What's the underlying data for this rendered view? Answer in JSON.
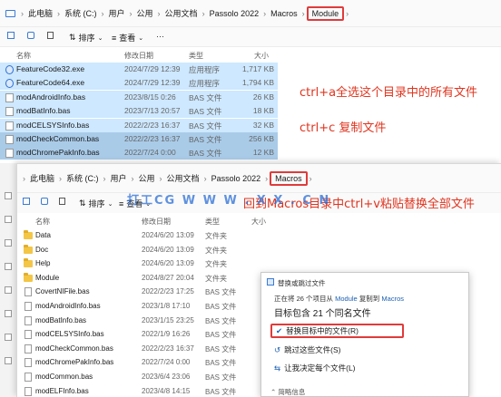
{
  "back_window": {
    "breadcrumbs": [
      "此电脑",
      "系统 (C:)",
      "用户",
      "公用",
      "公用文档",
      "Passolo 2022",
      "Macros",
      "Module"
    ],
    "toolbar": {
      "sort": "排序",
      "view": "查看",
      "more": "···"
    },
    "columns": {
      "name": "名称",
      "date": "修改日期",
      "type": "类型",
      "size": "大小"
    },
    "files": [
      {
        "name": "FeatureCode32.exe",
        "date": "2024/7/29 12:39",
        "type": "应用程序",
        "size": "1,717 KB"
      },
      {
        "name": "FeatureCode64.exe",
        "date": "2024/7/29 12:39",
        "type": "应用程序",
        "size": "1,794 KB"
      },
      {
        "name": "modAndroidInfo.bas",
        "date": "2023/8/15 0:26",
        "type": "BAS 文件",
        "size": "26 KB"
      },
      {
        "name": "modBatInfo.bas",
        "date": "2023/7/13 20:57",
        "type": "BAS 文件",
        "size": "18 KB"
      },
      {
        "name": "modCELSYSInfo.bas",
        "date": "2022/2/23 16:37",
        "type": "BAS 文件",
        "size": "32 KB"
      },
      {
        "name": "modCheckCommon.bas",
        "date": "2022/2/23 16:37",
        "type": "BAS 文件",
        "size": "256 KB"
      },
      {
        "name": "modChromePakInfo.bas",
        "date": "2022/7/24 0:00",
        "type": "BAS 文件",
        "size": "12 KB"
      }
    ]
  },
  "annotations": {
    "select_all": "ctrl+a全选这个目录中的所有文件",
    "copy": "ctrl+c 复制文件",
    "paste": "回到Macros目录中ctrl+v粘贴替换全部文件"
  },
  "watermark": "打工CG  W W W . X X . C N",
  "front_window": {
    "breadcrumbs": [
      "此电脑",
      "系统 (C:)",
      "用户",
      "公用",
      "公用文档",
      "Passolo 2022",
      "Macros"
    ],
    "toolbar": {
      "sort": "排序",
      "view": "查看",
      "more": "···"
    },
    "columns": {
      "name": "名称",
      "date": "修改日期",
      "type": "类型",
      "size": "大小"
    },
    "items": [
      {
        "name": "Data",
        "date": "2024/6/20 13:09",
        "type": "文件夹",
        "kind": "folder"
      },
      {
        "name": "Doc",
        "date": "2024/6/20 13:09",
        "type": "文件夹",
        "kind": "folder"
      },
      {
        "name": "Help",
        "date": "2024/6/20 13:09",
        "type": "文件夹",
        "kind": "folder"
      },
      {
        "name": "Module",
        "date": "2024/8/27 20:04",
        "type": "文件夹",
        "kind": "folder"
      },
      {
        "name": "CovertNIFile.bas",
        "date": "2022/2/23 17:25",
        "type": "BAS 文件",
        "kind": "file"
      },
      {
        "name": "modAndroidInfo.bas",
        "date": "2023/1/8 17:10",
        "type": "BAS 文件",
        "kind": "file"
      },
      {
        "name": "modBatInfo.bas",
        "date": "2023/1/15 23:25",
        "type": "BAS 文件",
        "kind": "file"
      },
      {
        "name": "modCELSYSInfo.bas",
        "date": "2022/1/9 16:26",
        "type": "BAS 文件",
        "kind": "file"
      },
      {
        "name": "modCheckCommon.bas",
        "date": "2022/2/23 16:37",
        "type": "BAS 文件",
        "kind": "file"
      },
      {
        "name": "modChromePakInfo.bas",
        "date": "2022/7/24 0:00",
        "type": "BAS 文件",
        "kind": "file"
      },
      {
        "name": "modCommon.bas",
        "date": "2023/6/4 23:06",
        "type": "BAS 文件",
        "kind": "file"
      },
      {
        "name": "modELFInfo.bas",
        "date": "2023/4/8 14:15",
        "type": "BAS 文件",
        "kind": "file"
      }
    ]
  },
  "dialog": {
    "title": "替换或跳过文件",
    "status_prefix": "正在将 26 个项目从",
    "status_source": "Module",
    "status_mid": "复制到",
    "status_dest": "Macros",
    "conflict_text": "目标包含 21 个同名文件",
    "option_replace": "替换目标中的文件(R)",
    "option_skip": "跳过这些文件(S)",
    "option_decide": "让我决定每个文件(L)",
    "details": "简略信息"
  },
  "colors": {
    "annotation": "#e0341e",
    "highlight_box": "#e03b3b",
    "selection": "#cde8ff",
    "watermark": "#2b6fd6"
  }
}
